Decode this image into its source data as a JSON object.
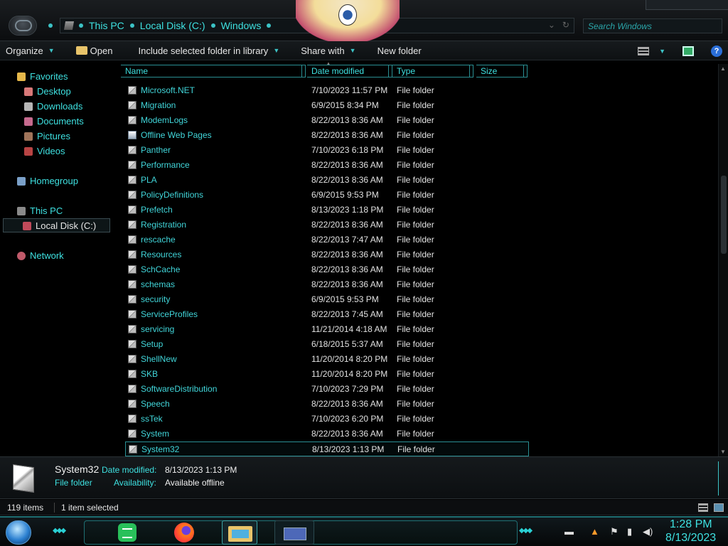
{
  "window": {
    "breadcrumb": [
      "This PC",
      "Local Disk (C:)",
      "Windows"
    ],
    "search_placeholder": "Search Windows"
  },
  "toolbar": {
    "organize": "Organize",
    "open": "Open",
    "include_library": "Include selected folder in library",
    "share_with": "Share with",
    "new_folder": "New folder",
    "help": "?"
  },
  "nav": {
    "favorites": "Favorites",
    "desktop": "Desktop",
    "downloads": "Downloads",
    "documents": "Documents",
    "pictures": "Pictures",
    "videos": "Videos",
    "homegroup": "Homegroup",
    "this_pc": "This PC",
    "local_disk": "Local Disk (C:)",
    "network": "Network"
  },
  "columns": {
    "name": "Name",
    "date_modified": "Date modified",
    "type": "Type",
    "size": "Size"
  },
  "files": [
    {
      "name": "Microsoft.NET",
      "date": "7/10/2023 11:57 PM",
      "type": "File folder"
    },
    {
      "name": "Migration",
      "date": "6/9/2015 8:34 PM",
      "type": "File folder"
    },
    {
      "name": "ModemLogs",
      "date": "8/22/2013 8:36 AM",
      "type": "File folder"
    },
    {
      "name": "Offline Web Pages",
      "date": "8/22/2013 8:36 AM",
      "type": "File folder"
    },
    {
      "name": "Panther",
      "date": "7/10/2023 6:18 PM",
      "type": "File folder"
    },
    {
      "name": "Performance",
      "date": "8/22/2013 8:36 AM",
      "type": "File folder"
    },
    {
      "name": "PLA",
      "date": "8/22/2013 8:36 AM",
      "type": "File folder"
    },
    {
      "name": "PolicyDefinitions",
      "date": "6/9/2015 9:53 PM",
      "type": "File folder"
    },
    {
      "name": "Prefetch",
      "date": "8/13/2023 1:18 PM",
      "type": "File folder"
    },
    {
      "name": "Registration",
      "date": "8/22/2013 8:36 AM",
      "type": "File folder"
    },
    {
      "name": "rescache",
      "date": "8/22/2013 7:47 AM",
      "type": "File folder"
    },
    {
      "name": "Resources",
      "date": "8/22/2013 8:36 AM",
      "type": "File folder"
    },
    {
      "name": "SchCache",
      "date": "8/22/2013 8:36 AM",
      "type": "File folder"
    },
    {
      "name": "schemas",
      "date": "8/22/2013 8:36 AM",
      "type": "File folder"
    },
    {
      "name": "security",
      "date": "6/9/2015 9:53 PM",
      "type": "File folder"
    },
    {
      "name": "ServiceProfiles",
      "date": "8/22/2013 7:45 AM",
      "type": "File folder"
    },
    {
      "name": "servicing",
      "date": "11/21/2014 4:18 AM",
      "type": "File folder"
    },
    {
      "name": "Setup",
      "date": "6/18/2015 5:37 AM",
      "type": "File folder"
    },
    {
      "name": "ShellNew",
      "date": "11/20/2014 8:20 PM",
      "type": "File folder"
    },
    {
      "name": "SKB",
      "date": "11/20/2014 8:20 PM",
      "type": "File folder"
    },
    {
      "name": "SoftwareDistribution",
      "date": "7/10/2023 7:29 PM",
      "type": "File folder"
    },
    {
      "name": "Speech",
      "date": "8/22/2013 8:36 AM",
      "type": "File folder"
    },
    {
      "name": "ssTek",
      "date": "7/10/2023 6:20 PM",
      "type": "File folder"
    },
    {
      "name": "System",
      "date": "8/22/2013 8:36 AM",
      "type": "File folder"
    },
    {
      "name": "System32",
      "date": "8/13/2023 1:13 PM",
      "type": "File folder",
      "selected": true
    }
  ],
  "details": {
    "name": "System32",
    "date_label": "Date modified:",
    "date_value": "8/13/2023 1:13 PM",
    "type_value": "File folder",
    "availability_label": "Availability:",
    "availability_value": "Available offline"
  },
  "status": {
    "item_count": "119 items",
    "selection": "1 item selected"
  },
  "taskbar": {
    "time": "1:28 PM",
    "date": "8/13/2023"
  },
  "colors": {
    "accent": "#3ee0e0",
    "background": "#000000"
  }
}
